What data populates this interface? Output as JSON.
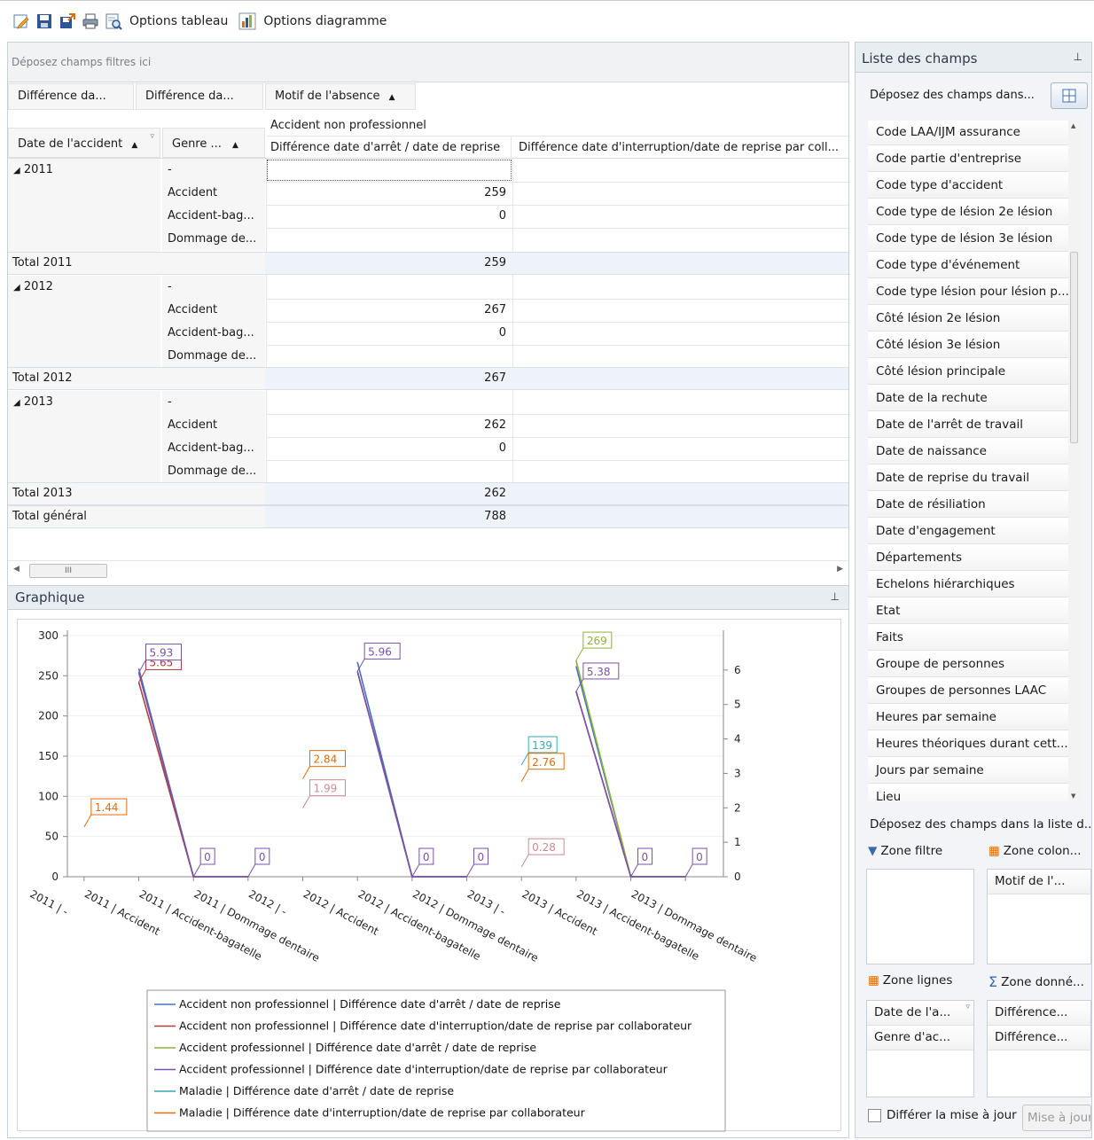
{
  "toolbar": {
    "icons": [
      "edit-icon",
      "save-icon",
      "export-icon",
      "print-icon",
      "preview-icon"
    ],
    "table_options": "Options tableau",
    "chart_options": "Options diagramme"
  },
  "pivot": {
    "filter_placeholder": "Déposez champs filtres ici",
    "data_headers": [
      "Différence da...",
      "Différence da..."
    ],
    "column_field": "Motif de l'absence",
    "column_value": "Accident non professionnel",
    "row_fields": [
      "Date de l'accident",
      "Genre ..."
    ],
    "col_headers": [
      "Différence date d'arrêt / date de reprise",
      "Différence date d'interruption/date de reprise par coll..."
    ],
    "groups": [
      {
        "year": "2011",
        "rows": [
          {
            "genre": "-",
            "v": ""
          },
          {
            "genre": "Accident",
            "v": "259"
          },
          {
            "genre": "Accident-bag...",
            "v": "0"
          },
          {
            "genre": "Dommage de...",
            "v": ""
          }
        ],
        "total_label": "Total 2011",
        "total": "259"
      },
      {
        "year": "2012",
        "rows": [
          {
            "genre": "-",
            "v": ""
          },
          {
            "genre": "Accident",
            "v": "267"
          },
          {
            "genre": "Accident-bag...",
            "v": "0"
          },
          {
            "genre": "Dommage de...",
            "v": ""
          }
        ],
        "total_label": "Total 2012",
        "total": "267"
      },
      {
        "year": "2013",
        "rows": [
          {
            "genre": "-",
            "v": ""
          },
          {
            "genre": "Accident",
            "v": "262"
          },
          {
            "genre": "Accident-bag...",
            "v": "0"
          },
          {
            "genre": "Dommage de...",
            "v": ""
          }
        ],
        "total_label": "Total 2013",
        "total": "262"
      }
    ],
    "grand_total_label": "Total général",
    "grand_total": "788",
    "scroll_thumb": "III"
  },
  "graph": {
    "title": "Graphique"
  },
  "chart_data": {
    "type": "line",
    "title": "",
    "categories": [
      "2011 | -",
      "2011 | Accident",
      "2011 | Accident-bagatelle",
      "2011 | Dommage dentaire",
      "2012 | -",
      "2012 | Accident",
      "2012 | Accident-bagatelle",
      "2012 | Dommage dentaire",
      "2013 | -",
      "2013 | Accident",
      "2013 | Accident-bagatelle",
      "2013 | Dommage dentaire"
    ],
    "ylim": [
      0,
      300
    ],
    "yticks": [
      0,
      50,
      100,
      150,
      200,
      250,
      300
    ],
    "y2lim": [
      0,
      7
    ],
    "y2ticks": [
      0,
      1,
      2,
      3,
      4,
      5,
      6
    ],
    "grid": true,
    "legend_position": "bottom",
    "series": [
      {
        "name": "Accident non professionnel | Différence date d'arrêt / date de reprise",
        "color": "#4572c4",
        "axis": "left",
        "values": [
          null,
          259,
          0,
          0,
          null,
          267,
          0,
          0,
          null,
          262,
          0,
          0
        ]
      },
      {
        "name": "Accident non professionnel | Différence date d'interruption/date de reprise par collaborateur",
        "color": "#b23b3b",
        "axis": "right",
        "values": [
          null,
          5.65,
          0,
          0,
          null,
          5.96,
          0,
          0,
          null,
          5.38,
          0,
          0
        ]
      },
      {
        "name": "Accident professionnel | Différence date d'arrêt / date de reprise",
        "color": "#8db33a",
        "axis": "left",
        "values": [
          null,
          null,
          null,
          null,
          null,
          null,
          null,
          null,
          null,
          269,
          0,
          0
        ]
      },
      {
        "name": "Accident professionnel | Différence date d'interruption/date de reprise par collaborateur",
        "color": "#7a52a8",
        "axis": "right",
        "values": [
          null,
          5.93,
          0,
          0,
          null,
          5.96,
          0,
          0,
          null,
          5.38,
          0,
          0
        ]
      },
      {
        "name": "Maladie | Différence date d'arrêt / date de reprise",
        "color": "#3ba6b5",
        "axis": "left",
        "values": [
          null,
          null,
          null,
          null,
          null,
          null,
          null,
          null,
          139,
          null,
          null,
          null
        ]
      },
      {
        "name": "Maladie | Différence date d'interruption/date de reprise par collaborateur",
        "color": "#e36c0a",
        "axis": "right",
        "values": [
          1.44,
          null,
          null,
          null,
          2.84,
          null,
          null,
          null,
          2.76,
          null,
          null,
          null
        ]
      }
    ],
    "data_labels": [
      {
        "text": "1.44",
        "color": "#e36c0a",
        "cat": 0,
        "axis": "right",
        "value": 1.44
      },
      {
        "text": "5.65",
        "color": "#b23b3b",
        "cat": 1,
        "axis": "right",
        "value": 5.65
      },
      {
        "text": "5.93",
        "color": "#7a52a8",
        "cat": 1,
        "axis": "right",
        "value": 5.93
      },
      {
        "text": "0",
        "color": "#7a52a8",
        "cat": 2,
        "axis": "right",
        "value": 0
      },
      {
        "text": "0",
        "color": "#7a52a8",
        "cat": 3,
        "axis": "right",
        "value": 0
      },
      {
        "text": "2.84",
        "color": "#e36c0a",
        "cat": 4,
        "axis": "right",
        "value": 2.84
      },
      {
        "text": "1.99",
        "color": "#c98a94",
        "cat": 4,
        "axis": "right",
        "value": 1.99
      },
      {
        "text": "5.96",
        "color": "#7a52a8",
        "cat": 5,
        "axis": "right",
        "value": 5.96
      },
      {
        "text": "0",
        "color": "#7a52a8",
        "cat": 6,
        "axis": "right",
        "value": 0
      },
      {
        "text": "0",
        "color": "#7a52a8",
        "cat": 7,
        "axis": "right",
        "value": 0
      },
      {
        "text": "139",
        "color": "#3ba6b5",
        "cat": 8,
        "axis": "left",
        "value": 139
      },
      {
        "text": "2.76",
        "color": "#e36c0a",
        "cat": 8,
        "axis": "right",
        "value": 2.76
      },
      {
        "text": "0.28",
        "color": "#c98a94",
        "cat": 8,
        "axis": "right",
        "value": 0.28
      },
      {
        "text": "269",
        "color": "#8db33a",
        "cat": 9,
        "axis": "left",
        "value": 269
      },
      {
        "text": "5.38",
        "color": "#7a52a8",
        "cat": 9,
        "axis": "right",
        "value": 5.38
      },
      {
        "text": "0",
        "color": "#7a52a8",
        "cat": 10,
        "axis": "right",
        "value": 0
      },
      {
        "text": "0",
        "color": "#7a52a8",
        "cat": 11,
        "axis": "right",
        "value": 0
      }
    ]
  },
  "field_list": {
    "title": "Liste des champs",
    "drop_hint": "Déposez des champs dans...",
    "fields": [
      "Code LAA/IJM assurance",
      "Code partie d'entreprise",
      "Code type d'accident",
      "Code type de lésion 2e lésion",
      "Code type de lésion 3e lésion",
      "Code type d'événement",
      "Code type lésion pour lésion p...",
      "Côté lésion 2e lésion",
      "Côté lésion 3e lésion",
      "Côté lésion principale",
      "Date de la rechute",
      "Date de l'arrêt de travail",
      "Date de naissance",
      "Date de reprise du travail",
      "Date de résiliation",
      "Date d'engagement",
      "Départements",
      "Echelons hiérarchiques",
      "Etat",
      "Faits",
      "Groupe de personnes",
      "Groupes de personnes LAAC",
      "Heures par semaine",
      "Heures théoriques durant cett...",
      "Jours par semaine",
      "Lieu"
    ],
    "drop_hint2": "Déposez des champs dans la liste d...",
    "zone_filter": "Zone filtre",
    "zone_columns": "Zone colon...",
    "zone_columns_items": [
      "Motif de l'..."
    ],
    "zone_rows": "Zone lignes",
    "zone_rows_items": [
      "Date de l'a...",
      "Genre d'ac..."
    ],
    "zone_data": "Zone donné...",
    "zone_data_items": [
      "Différence...",
      "Différence..."
    ],
    "defer_label": "Différer la mise à jour",
    "update_button": "Mise à jour"
  }
}
